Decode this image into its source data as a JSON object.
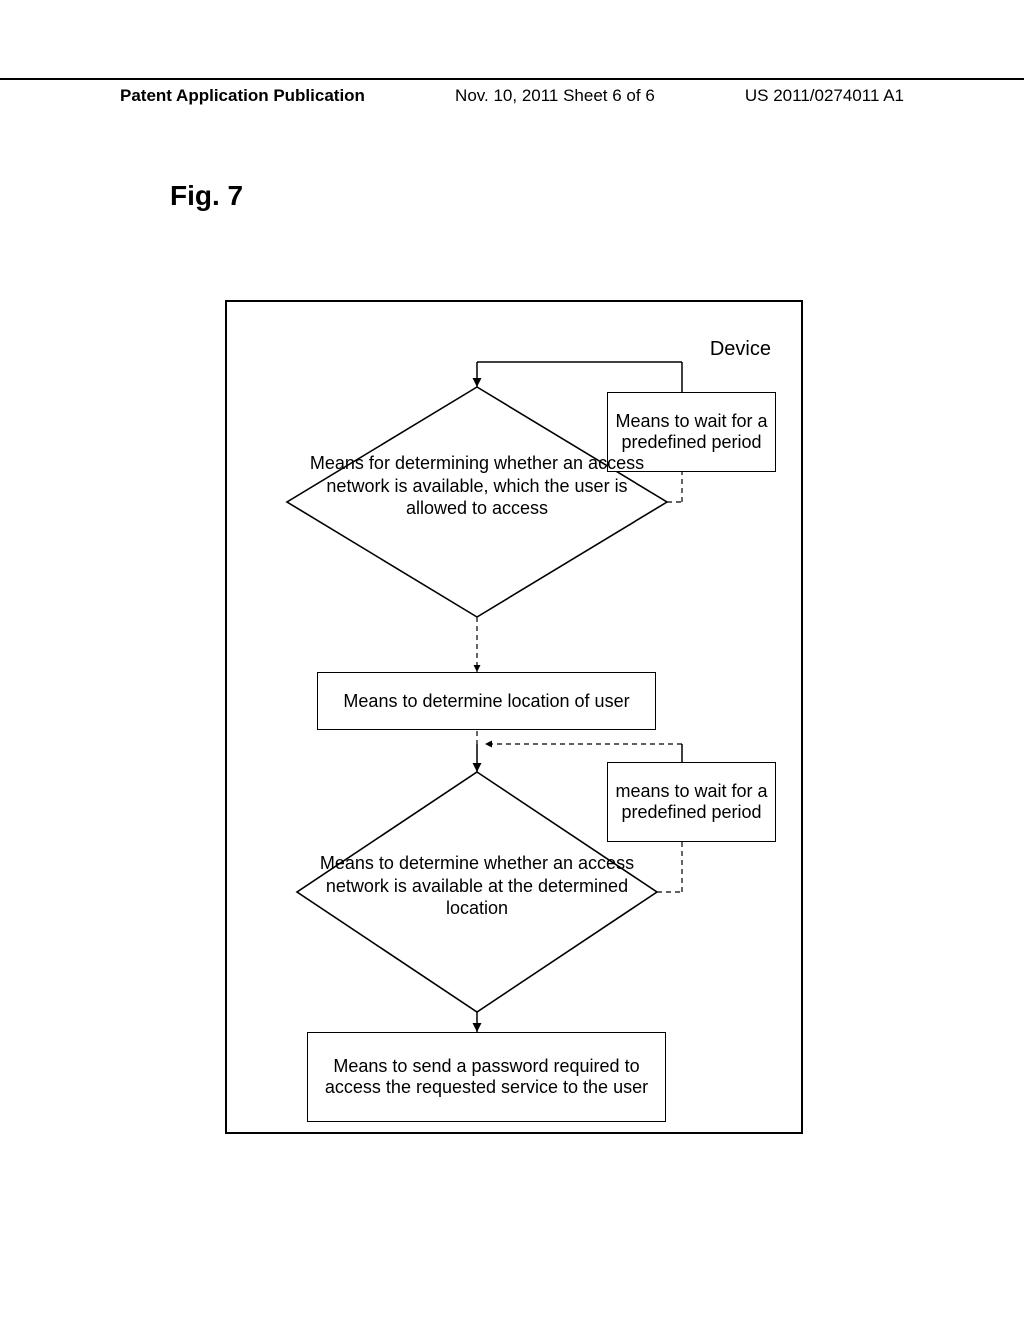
{
  "header": {
    "left": "Patent Application Publication",
    "center": "Nov. 10, 2011  Sheet 6 of 6",
    "right": "US 2011/0274011 A1"
  },
  "figure_label": "Fig. 7",
  "diagram": {
    "device_label": "Device",
    "decision1": "Means for determining whether an access network is available, which the user is allowed to access",
    "wait1": "Means to wait for a predefined period",
    "location_box": "Means to determine location of user",
    "wait2": "means to wait for a predefined period",
    "decision2": "Means to determine whether an access network is available at the determined location",
    "send_box": "Means to send a password required to access the requested service to the user"
  }
}
